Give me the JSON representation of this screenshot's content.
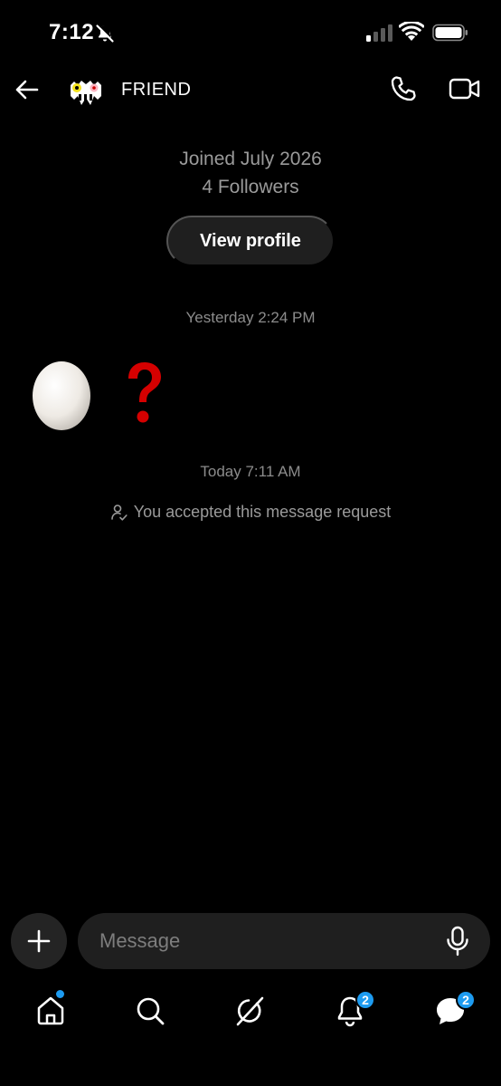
{
  "status_bar": {
    "time": "7:12"
  },
  "header": {
    "contact_name": "FRIEND"
  },
  "profile": {
    "joined": "Joined July 2026",
    "followers": "4 Followers",
    "view_profile_label": "View profile"
  },
  "messages": {
    "timestamp_1": "Yesterday 2:24 PM",
    "timestamp_2": "Today 7:11 AM",
    "request_text": "You accepted this message request"
  },
  "composer": {
    "placeholder": "Message"
  },
  "nav": {
    "notifications_badge": "2",
    "messages_badge": "2"
  },
  "colors": {
    "accent": "#1d9bf0",
    "background": "#000000",
    "pill": "#1f1f1f",
    "question_mark": "#d50000"
  },
  "icons": [
    "bell-slash-icon",
    "signal-icon",
    "wifi-icon",
    "battery-icon",
    "back-arrow-icon",
    "phone-icon",
    "video-icon",
    "plus-icon",
    "mic-icon",
    "home-icon",
    "search-icon",
    "grok-icon",
    "bell-icon",
    "messages-icon",
    "person-check-icon"
  ]
}
